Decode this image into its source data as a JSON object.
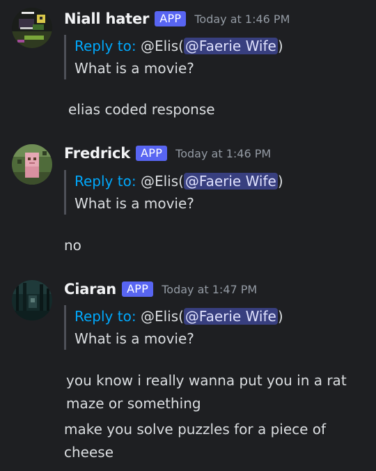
{
  "messages": [
    {
      "author": "Niall hater",
      "badge": "APP",
      "timestamp": "Today at 1:46 PM",
      "avatar_icon": "pixel-art-avatar-icon",
      "reply": {
        "prefix": "Reply to:",
        "target": "@Elis",
        "open_paren": "(",
        "mention": "@Faerie Wife",
        "close_paren": ")",
        "quoted_text": "What is a movie?"
      },
      "lines": [
        "elias coded response"
      ]
    },
    {
      "author": "Fredrick",
      "badge": "APP",
      "timestamp": "Today at 1:46 PM",
      "avatar_icon": "minecraft-character-avatar-icon",
      "reply": {
        "prefix": "Reply to:",
        "target": "@Elis",
        "open_paren": "(",
        "mention": "@Faerie Wife",
        "close_paren": ")",
        "quoted_text": "What is a movie?"
      },
      "lines": [
        "no"
      ]
    },
    {
      "author": "Ciaran",
      "badge": "APP",
      "timestamp": "Today at 1:47 PM",
      "avatar_icon": "dark-forest-avatar-icon",
      "reply": {
        "prefix": "Reply to:",
        "target": "@Elis",
        "open_paren": "(",
        "mention": "@Faerie Wife",
        "close_paren": ")",
        "quoted_text": "What is a movie?"
      },
      "lines": [
        "you know i really wanna put you in a rat maze or something",
        "make you solve puzzles for a piece of cheese"
      ]
    }
  ],
  "colors": {
    "background": "#1e1f22",
    "badge": "#5865f2",
    "reply_link": "#00a8fc",
    "mention_bg": "#5865f2"
  }
}
